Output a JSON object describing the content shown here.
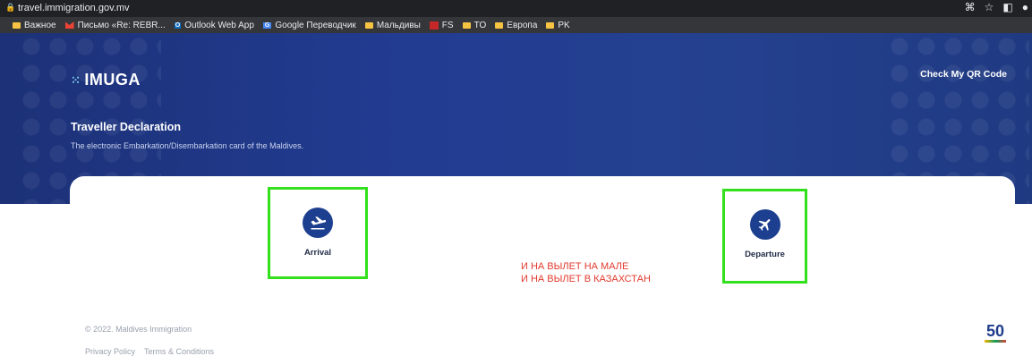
{
  "browser": {
    "url": "travel.immigration.gov.mv",
    "right_icons": [
      "translate-icon",
      "star-icon",
      "sidepanel-icon",
      "profile-icon"
    ]
  },
  "bookmarks": [
    {
      "label": "Важное",
      "icon": "folder-icon"
    },
    {
      "label": "Письмо «Re: REBR...",
      "icon": "gmail-icon"
    },
    {
      "label": "Outlook Web App",
      "icon": "outlook-icon"
    },
    {
      "label": "Google Переводчик",
      "icon": "google-translate-icon"
    },
    {
      "label": "Мальдивы",
      "icon": "folder-icon"
    },
    {
      "label": "FS",
      "icon": "fs-icon"
    },
    {
      "label": "TO",
      "icon": "folder-icon"
    },
    {
      "label": "Европа",
      "icon": "folder-icon"
    },
    {
      "label": "PK",
      "icon": "folder-icon"
    }
  ],
  "header": {
    "logo_text": "IMUGA",
    "qr_link": "Check My QR Code",
    "title": "Traveller Declaration",
    "subtitle": "The electronic Embarkation/Disembarkation card of the Maldives."
  },
  "options": {
    "arrival": {
      "label": "Arrival",
      "icon": "plane-landing-icon"
    },
    "departure": {
      "label": "Departure",
      "icon": "plane-takeoff-icon"
    }
  },
  "annotation": {
    "line1": "И НА ВЫЛЕТ НА МАЛЕ",
    "line2": "И НА ВЫЛЕТ В КАЗАХСТАН"
  },
  "footer": {
    "copyright": "© 2022. Maldives Immigration",
    "privacy": "Privacy Policy",
    "terms": "Terms & Conditions",
    "badge": "50"
  },
  "colors": {
    "hero": "#223c92",
    "icon_circle": "#1d3f8f",
    "highlight": "#32e01c",
    "annotation": "#e23a2e"
  }
}
